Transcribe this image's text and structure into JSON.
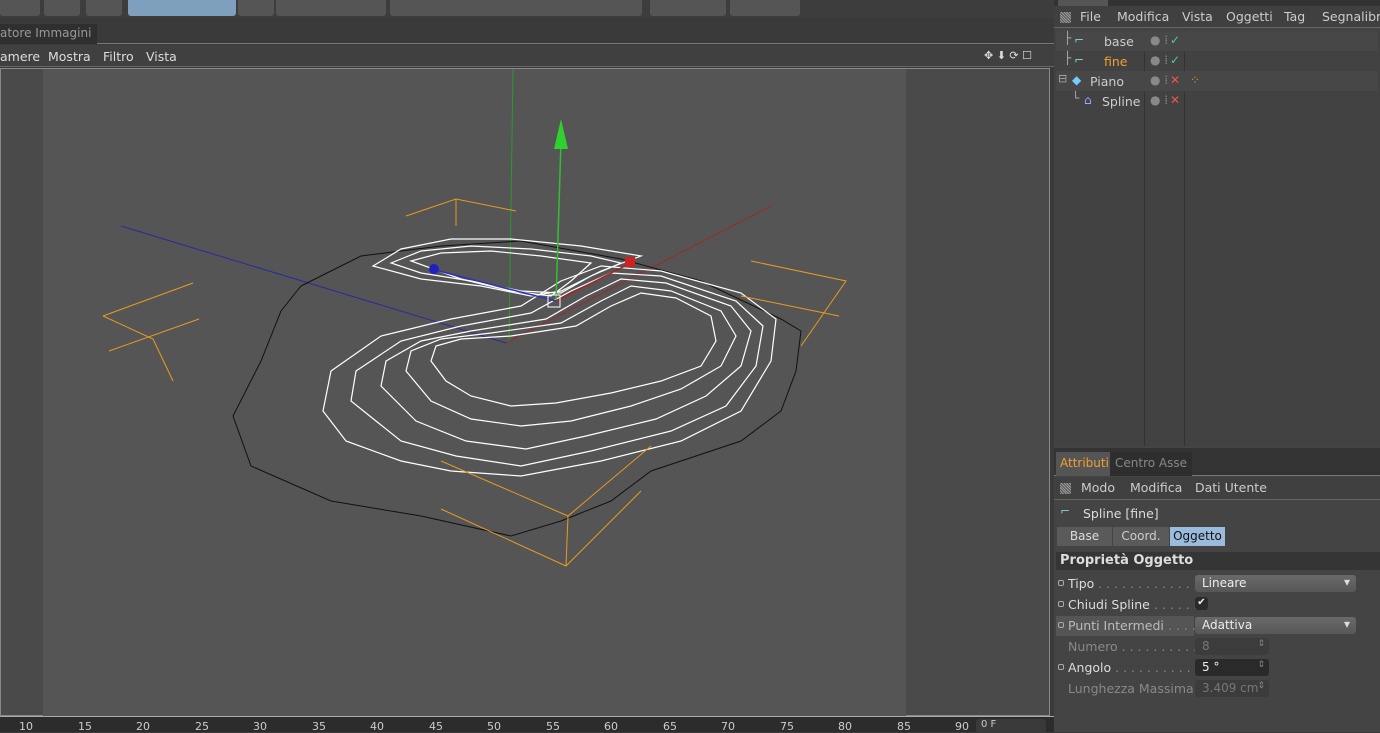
{
  "viewport_panel": {
    "tab_label": "atore Immagini",
    "menu": [
      "amere",
      "Mostra",
      "Filtro",
      "Vista"
    ],
    "timeline_ticks": [
      "10",
      "15",
      "20",
      "25",
      "30",
      "35",
      "40",
      "45",
      "50",
      "55",
      "60",
      "65",
      "70",
      "75",
      "80",
      "85",
      "90"
    ],
    "timeline_field": "0 F"
  },
  "object_manager": {
    "menu": [
      "File",
      "Modifica",
      "Vista",
      "Oggetti",
      "Tag",
      "Segnalibri"
    ],
    "objects": [
      {
        "name": "base",
        "type": "spline-icon",
        "status": "enabled",
        "color": "#cccccc"
      },
      {
        "name": "fine",
        "type": "spline-icon",
        "status": "enabled",
        "color": "#f0a030"
      },
      {
        "name": "Piano",
        "type": "plane-icon",
        "status": "disabled",
        "color": "#cccccc"
      },
      {
        "name": "Spline",
        "type": "spline-mask-icon",
        "status": "disabled",
        "color": "#cccccc"
      }
    ]
  },
  "attributes": {
    "tabs": [
      "Attributi",
      "Centro Asse"
    ],
    "active_tab": "Attributi",
    "menu": [
      "Modo",
      "Modifica",
      "Dati Utente"
    ],
    "object_title": "Spline [fine]",
    "subtabs": [
      "Base",
      "Coord.",
      "Oggetto"
    ],
    "active_subtab": "Oggetto",
    "section": "Proprietà Oggetto",
    "props": {
      "tipo": {
        "label": "Tipo",
        "value": "Lineare"
      },
      "chiudi": {
        "label": "Chiudi Spline",
        "checked": true,
        "mark": "✔"
      },
      "punti": {
        "label": "Punti Intermedi",
        "value": "Adattiva"
      },
      "numero": {
        "label": "Numero",
        "value": "8"
      },
      "angolo": {
        "label": "Angolo",
        "value": "5 °"
      },
      "lunghezza": {
        "label": "Lunghezza Massima",
        "value": "3.409 cm"
      }
    }
  },
  "colors": {
    "accent": "#f0a030",
    "selected_tab": "#9bbbdd",
    "axis_x": "#b03030",
    "axis_y": "#30c030",
    "axis_z": "#3030b0"
  }
}
